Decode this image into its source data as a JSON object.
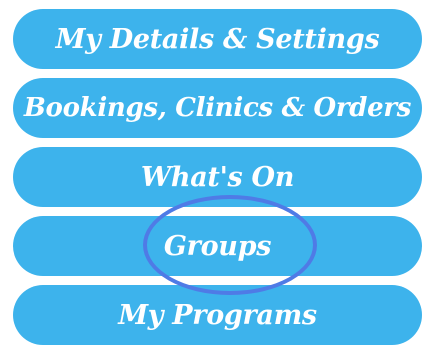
{
  "menu": {
    "items": [
      {
        "label": "My Details & Settings"
      },
      {
        "label": "Bookings, Clinics & Orders"
      },
      {
        "label": "What's On"
      },
      {
        "label": "Groups"
      },
      {
        "label": "My Programs"
      }
    ]
  },
  "colors": {
    "button_background": "#3db3ec",
    "button_text": "#ffffff",
    "highlight_ring": "#4f7be6"
  }
}
